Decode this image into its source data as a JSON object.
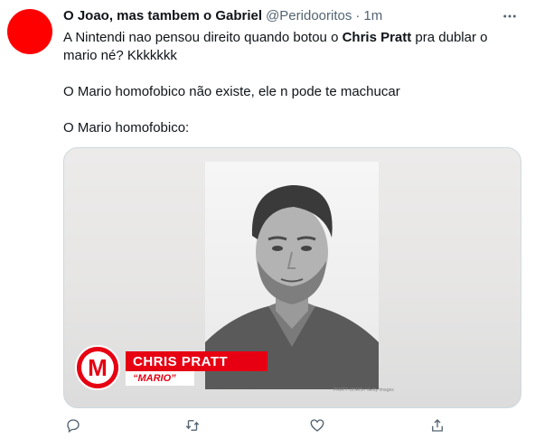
{
  "tweet": {
    "display_name": "O Joao, mas tambem o Gabriel",
    "handle": "@Peridooritos",
    "separator": "·",
    "time": "1m",
    "line1_pre": "A Nintendi nao pensou direito quando botou o ",
    "line1_bold": "Chris Pratt",
    "line1_post": " pra dublar o mario né? Kkkkkkk",
    "line2": "O Mario homofobico não existe, ele n pode te machucar",
    "line3": "O Mario homofobico:"
  },
  "media": {
    "logo_letter": "M",
    "nameplate": "CHRIS PRATT",
    "role": "“MARIO”",
    "credit": "PRATT CHRIS / Getty Images"
  },
  "icons": {
    "more": "more-horizontal-icon",
    "reply": "reply-icon",
    "retweet": "retweet-icon",
    "like": "like-icon",
    "share": "share-icon"
  },
  "colors": {
    "avatar": "#ff0000",
    "secondary_text": "#536471",
    "brand_red": "#e60012"
  }
}
